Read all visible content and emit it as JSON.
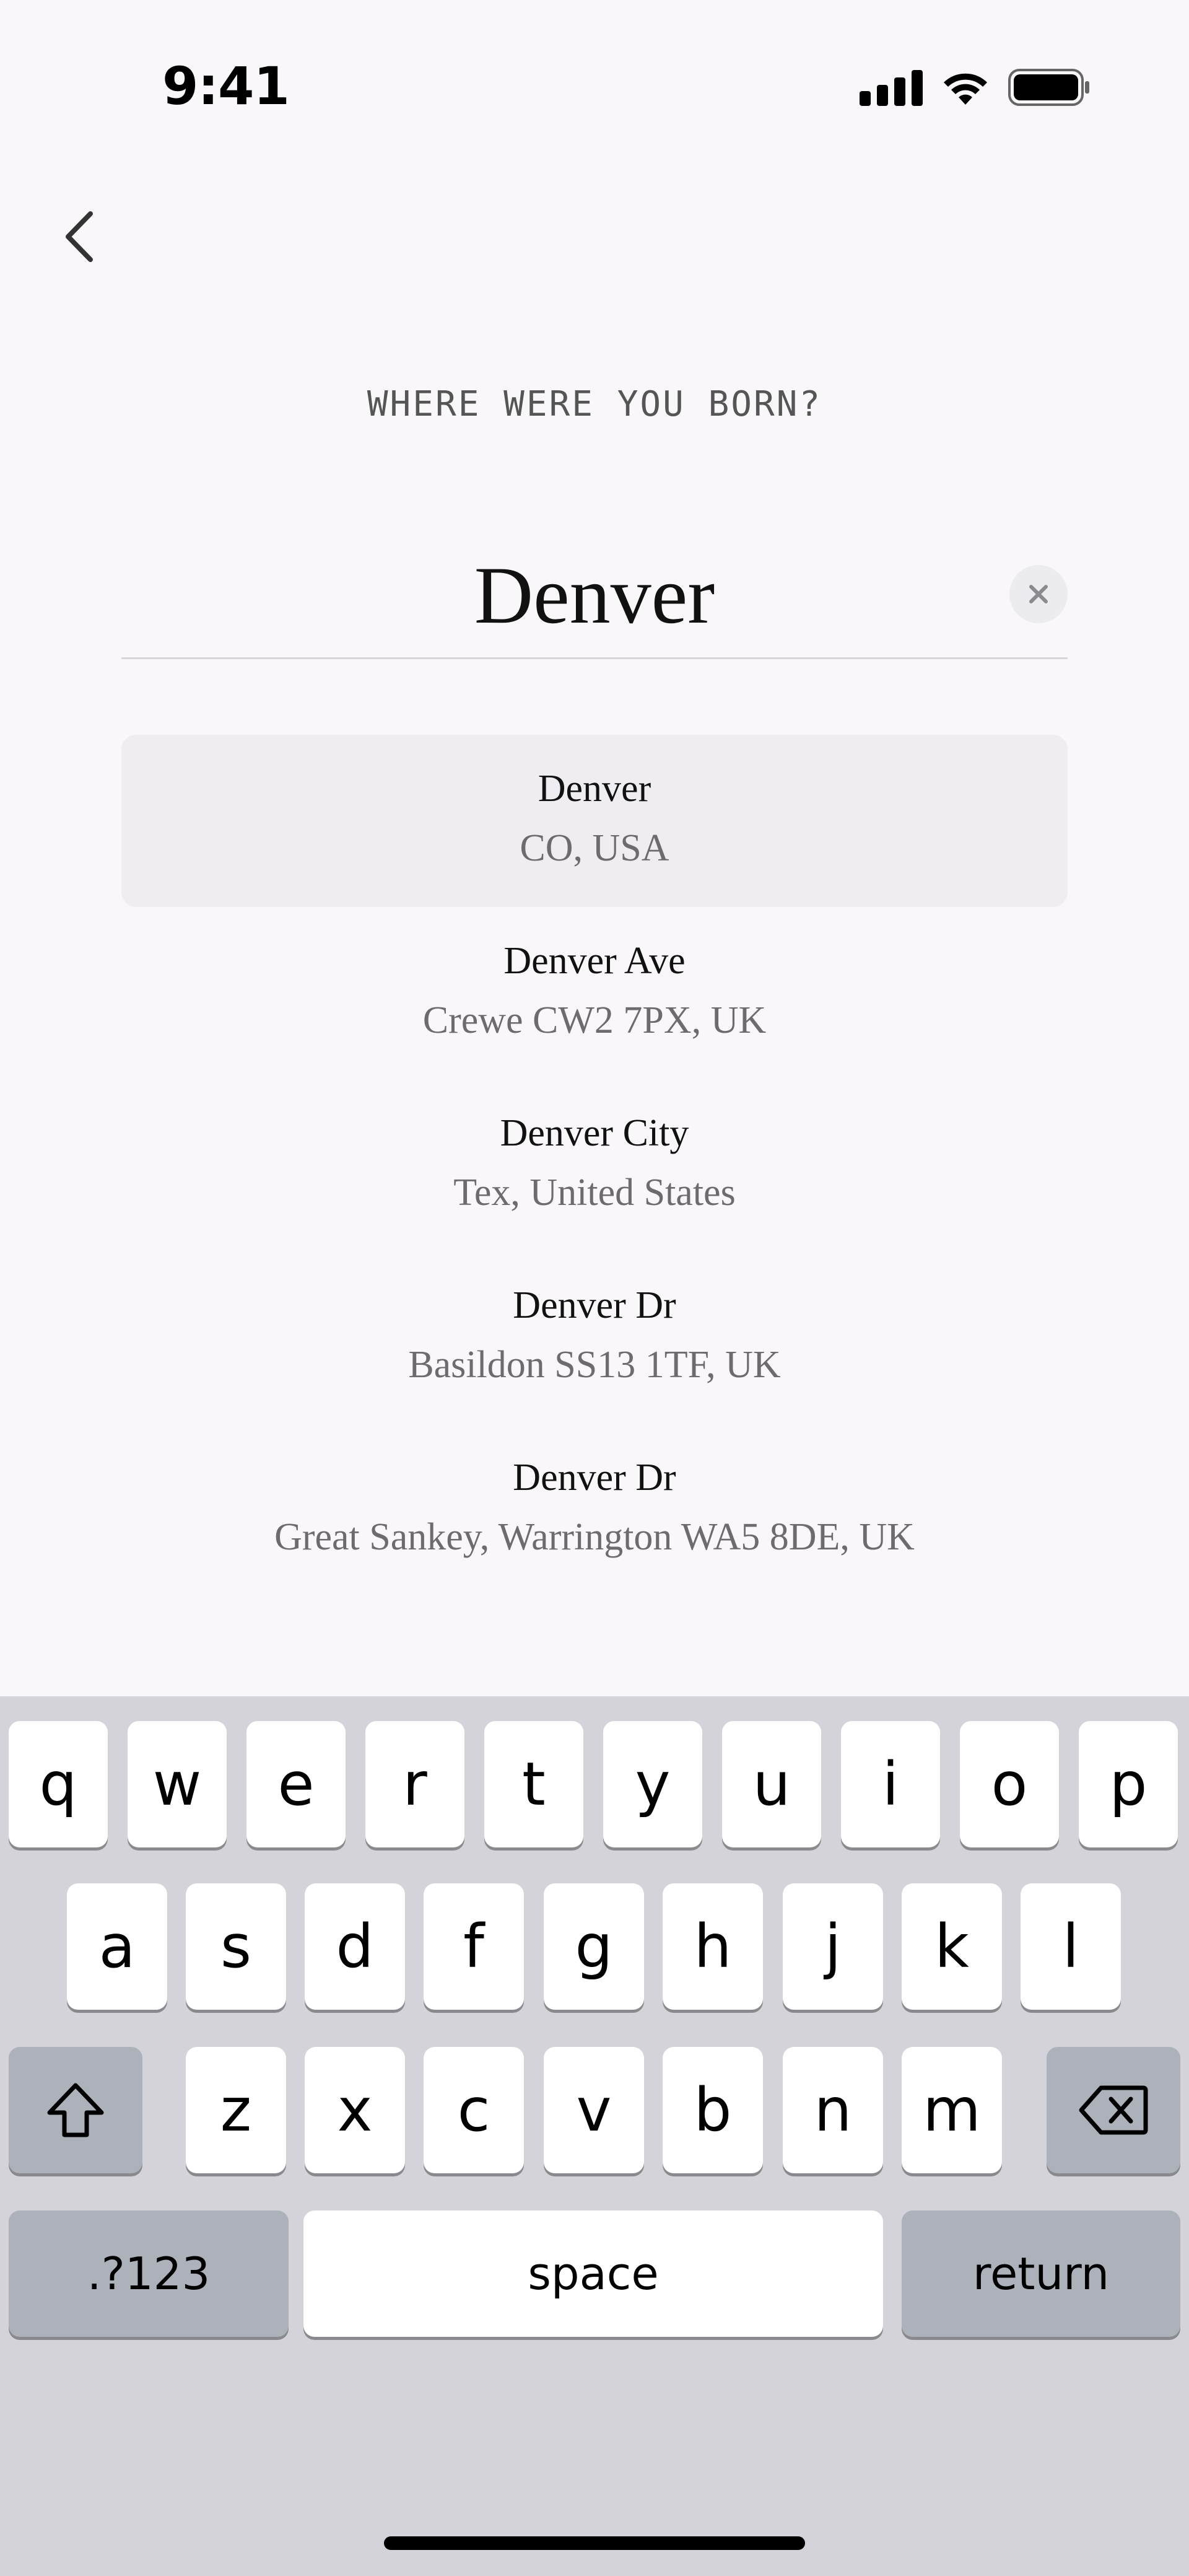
{
  "status_bar": {
    "time": "9:41",
    "icons": [
      "signal-icon",
      "wifi-icon",
      "battery-icon"
    ]
  },
  "nav": {
    "back_icon": "chevron-left-icon"
  },
  "question": "WHERE WERE YOU BORN?",
  "search": {
    "value": "Denver",
    "clear_icon": "close-icon"
  },
  "results": [
    {
      "name": "Denver",
      "detail": "CO, USA",
      "selected": true
    },
    {
      "name": "Denver Ave",
      "detail": "Crewe CW2 7PX, UK"
    },
    {
      "name": "Denver City",
      "detail": "Tex, United States"
    },
    {
      "name": "Denver Dr",
      "detail": "Basildon SS13 1TF, UK"
    },
    {
      "name": "Denver Dr",
      "detail": "Great Sankey, Warrington WA5 8DE, UK"
    }
  ],
  "keyboard": {
    "row1": [
      "q",
      "w",
      "e",
      "r",
      "t",
      "y",
      "u",
      "i",
      "o",
      "p"
    ],
    "row2": [
      "a",
      "s",
      "d",
      "f",
      "g",
      "h",
      "j",
      "k",
      "l"
    ],
    "row3": [
      "z",
      "x",
      "c",
      "v",
      "b",
      "n",
      "m"
    ],
    "shift_icon": "shift-icon",
    "delete_icon": "backspace-icon",
    "numbers_label": ".?123",
    "space_label": "space",
    "return_label": "return"
  },
  "colors": {
    "background": "#f9f7fa",
    "selected_row": "#efedf1",
    "keyboard": "#d3d3d9"
  }
}
